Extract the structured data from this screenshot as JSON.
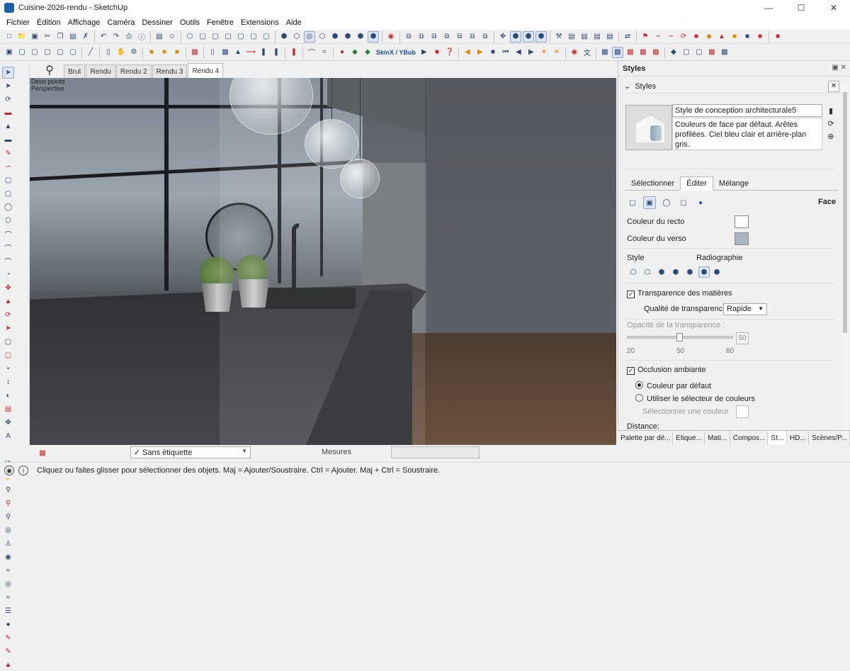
{
  "window": {
    "title": "Cuisine-2026-rendu - SketchUp"
  },
  "menu": [
    "Fichier",
    "Édition",
    "Affichage",
    "Caméra",
    "Dessiner",
    "Outils",
    "Fenêtre",
    "Extensions",
    "Aide"
  ],
  "toolbar": {
    "skinx_label": "SkinX / YBub"
  },
  "scene_tabs": [
    "Brut",
    "Rendu",
    "Rendu 2",
    "Rendu 3",
    "Rendu 4"
  ],
  "viewport": {
    "label_line1": "Deux points",
    "label_line2": "Perspective"
  },
  "panel": {
    "title": "Styles",
    "section": "Styles",
    "style_name": "Style de conception architecturale5",
    "style_description": "Couleurs de face par défaut. Arêtes profilées. Ciel bleu clair et arrière-plan gris.",
    "tabs": [
      "Sélectionner",
      "Éditer",
      "Mélange"
    ],
    "face_label": "Face",
    "front_color_label": "Couleur du recto",
    "back_color_label": "Couleur du verso",
    "front_color": "#ffffff",
    "back_color": "#a8b6c4",
    "style_label": "Style",
    "xray_label": "Radiographie",
    "transparency_label": "Transparence des matières",
    "transparency_quality_label": "Qualité de transparence:",
    "transparency_quality_value": "Rapide",
    "opacity_label": "Opacité de la transparence :",
    "opacity_value": "50",
    "opacity_ticks": [
      "20",
      "50",
      "80"
    ],
    "ambient_occlusion_label": "Occlusion ambiante",
    "default_color_label": "Couleur par défaut",
    "use_color_picker_label": "Utiliser le sélecteur de couleurs",
    "select_color_label": "Sélectionner une couleur",
    "distance_label": "Distance:"
  },
  "bottom_tabs": [
    "Palette par dé...",
    "Etique...",
    "Mati...",
    "Compos...",
    "St...",
    "HD...",
    "Scènes/P..."
  ],
  "status": {
    "tag_value": "Sans étiquette",
    "measures_label": "Mesures",
    "hint": "Cliquez ou faites glisser pour sélectionner des objets. Maj = Ajouter/Soustraire. Ctrl = Ajouter. Maj + Ctrl = Soustraire."
  }
}
